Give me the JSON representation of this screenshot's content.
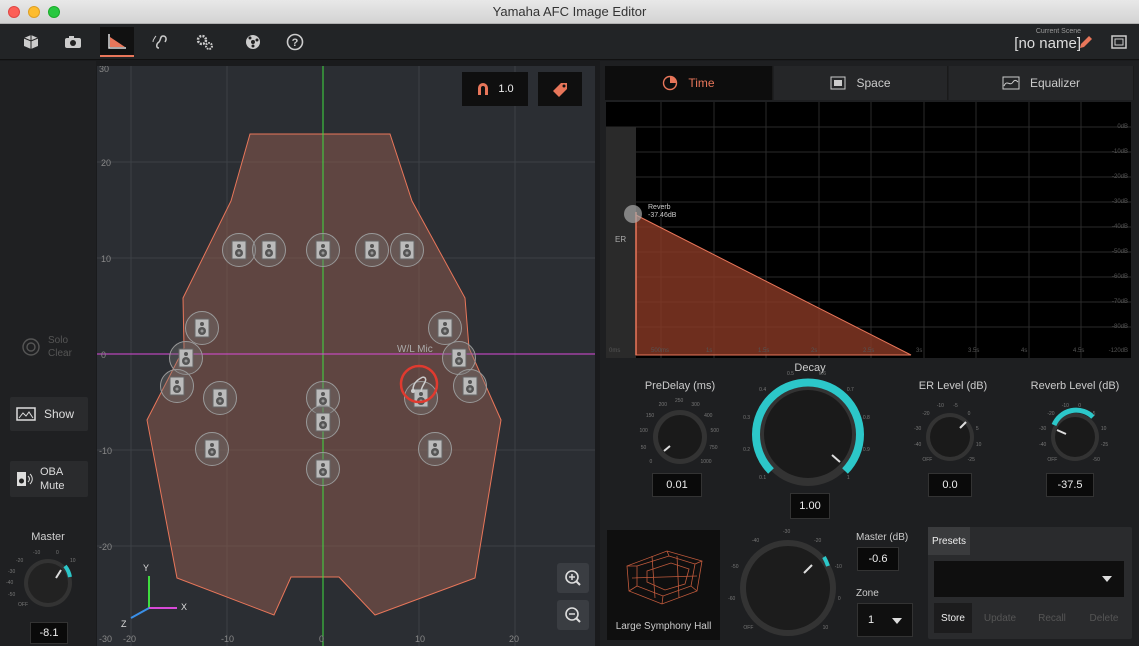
{
  "window": {
    "title": "Yamaha AFC Image Editor"
  },
  "toolbar": {
    "scene_label": "Current Scene",
    "scene_name": "[no name]",
    "icons": [
      "cube-icon",
      "camera-icon",
      "time-graph-icon",
      "ear-icon",
      "gears-icon",
      "network-icon",
      "help-icon"
    ]
  },
  "left": {
    "solo_label": "Solo",
    "clear_label": "Clear",
    "show_label": "Show",
    "oba_label": "OBA",
    "mute_label": "Mute",
    "master_label": "Master",
    "master_value": "-8.1",
    "master_scale": [
      "-20",
      "-10",
      "0",
      "10",
      "-30",
      "-40",
      "-50",
      "OFF"
    ]
  },
  "canvas": {
    "magnet_value": "1.0",
    "x_ticks": [
      "-20",
      "-10",
      "0",
      "10",
      "20"
    ],
    "y_ticks": [
      "30",
      "20",
      "10",
      "0",
      "-10",
      "-20",
      "-30"
    ],
    "mic_label": "W/L Mic",
    "axis_x": "X",
    "axis_y": "Y",
    "axis_z": "Z"
  },
  "tabs": [
    {
      "label": "Time",
      "icon": "clock-icon",
      "active": true
    },
    {
      "label": "Space",
      "icon": "space-icon",
      "active": false
    },
    {
      "label": "Equalizer",
      "icon": "equalizer-icon",
      "active": false
    }
  ],
  "graph": {
    "er_label": "ER",
    "reverb_label": "Reverb",
    "reverb_value": "-37.46dB",
    "x_ticks": [
      "0ms",
      "500ms",
      "1s",
      "1.5s",
      "2s",
      "2.5s",
      "3s",
      "3.5s",
      "4s",
      "4.5s"
    ],
    "y_ticks": [
      "0dB",
      "-10dB",
      "-20dB",
      "-30dB",
      "-40dB",
      "-50dB",
      "-60dB",
      "-70dB",
      "-80dB",
      "-120dB"
    ]
  },
  "controls": {
    "predelay_label": "PreDelay (ms)",
    "predelay_value": "0.01",
    "predelay_scale": [
      "0",
      "50",
      "100",
      "150",
      "200",
      "250",
      "300",
      "400",
      "500",
      "750",
      "1000"
    ],
    "decay_label": "Decay",
    "decay_value": "1.00",
    "decay_scale": [
      "0.1",
      "0.2",
      "0.3",
      "0.4",
      "0.5",
      "0.6",
      "0.7",
      "0.8",
      "0.9",
      "1"
    ],
    "er_label": "ER Level (dB)",
    "er_value": "0.0",
    "er_scale": [
      "OFF",
      "-40",
      "-30",
      "-20",
      "-10",
      "-5",
      "0",
      "5",
      "10",
      "-25"
    ],
    "reverb_label": "Reverb Level (dB)",
    "reverb_value": "-37.5",
    "reverb_scale": [
      "OFF",
      "-40",
      "-30",
      "-20",
      "-10",
      "0",
      "5",
      "10",
      "-25",
      "-50"
    ]
  },
  "bottom": {
    "hall_name": "Large Symphony Hall",
    "master_label": "Master (dB)",
    "master_value": "-0.6",
    "zone_label": "Zone",
    "zone_value": "1",
    "big_knob_scale": [
      "OFF",
      "-60",
      "-50",
      "-40",
      "-30",
      "-20",
      "-10",
      "0",
      "10"
    ],
    "presets_tab": "Presets",
    "preset_selected": "",
    "store_label": "Store",
    "update_label": "Update",
    "recall_label": "Recall",
    "delete_label": "Delete"
  },
  "colors": {
    "accent": "#e8765a",
    "teal": "#2cc7c9",
    "green_axis": "#3fdc3f",
    "magenta_axis": "#d84ad8"
  }
}
